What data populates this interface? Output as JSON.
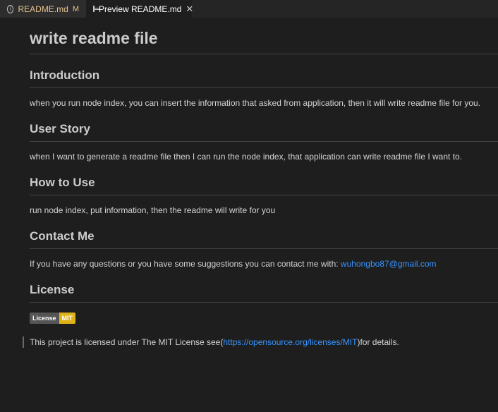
{
  "tabs": [
    {
      "label": "README.md",
      "badge": "M",
      "icon": "info-icon"
    },
    {
      "label": "Preview README.md",
      "icon": "preview-icon",
      "close_icon": "close-icon"
    }
  ],
  "doc": {
    "title": "write readme file",
    "sections": [
      {
        "heading": "Introduction",
        "text": "when you run node index, you can insert the information that asked from application, then it will write readme file for you."
      },
      {
        "heading": "User Story",
        "text": "when I want to generate a readme file then I can run the node index, that application can write readme file I want to."
      },
      {
        "heading": "How to Use",
        "text": "run node index, put information, then the readme will write for you"
      },
      {
        "heading": "Contact Me",
        "text": "If you have any questions or you have some suggestions you can contact me with: ",
        "link": "wuhongbo87@gmail.com"
      },
      {
        "heading": "License"
      }
    ],
    "badge": {
      "left": "License",
      "right": "MIT"
    },
    "quote": {
      "before": "This project is licensed under The MIT License see(",
      "link": "https://opensource.org/licenses/MIT",
      "after": ")for details."
    }
  },
  "colors": {
    "link": "#3794ff",
    "badge_right": "#dfb317",
    "modified": "#e2c08d"
  }
}
